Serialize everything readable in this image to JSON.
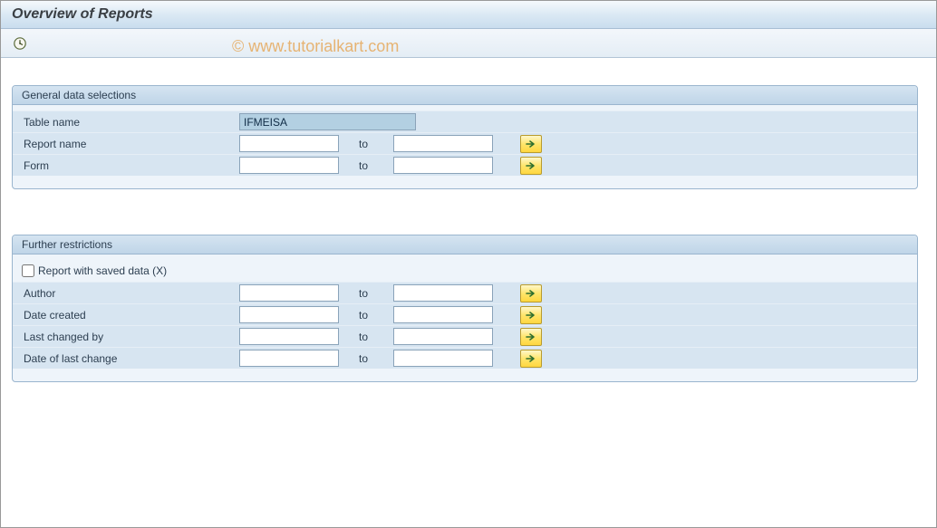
{
  "header": {
    "title": "Overview of Reports"
  },
  "watermark": "© www.tutorialkart.com",
  "groups": {
    "general": {
      "title": "General data selections",
      "fields": {
        "table_name": {
          "label": "Table name",
          "value": "IFMEISA"
        },
        "report_name": {
          "label": "Report name",
          "from": "",
          "to_label": "to",
          "to": ""
        },
        "form": {
          "label": "Form",
          "from": "",
          "to_label": "to",
          "to": ""
        }
      }
    },
    "further": {
      "title": "Further restrictions",
      "checkbox": {
        "label": "Report with saved data (X)",
        "checked": false
      },
      "fields": {
        "author": {
          "label": "Author",
          "from": "",
          "to_label": "to",
          "to": ""
        },
        "date_created": {
          "label": "Date created",
          "from": "",
          "to_label": "to",
          "to": ""
        },
        "last_changed_by": {
          "label": "Last changed by",
          "from": "",
          "to_label": "to",
          "to": ""
        },
        "date_last_change": {
          "label": "Date of last change",
          "from": "",
          "to_label": "to",
          "to": ""
        }
      }
    }
  }
}
